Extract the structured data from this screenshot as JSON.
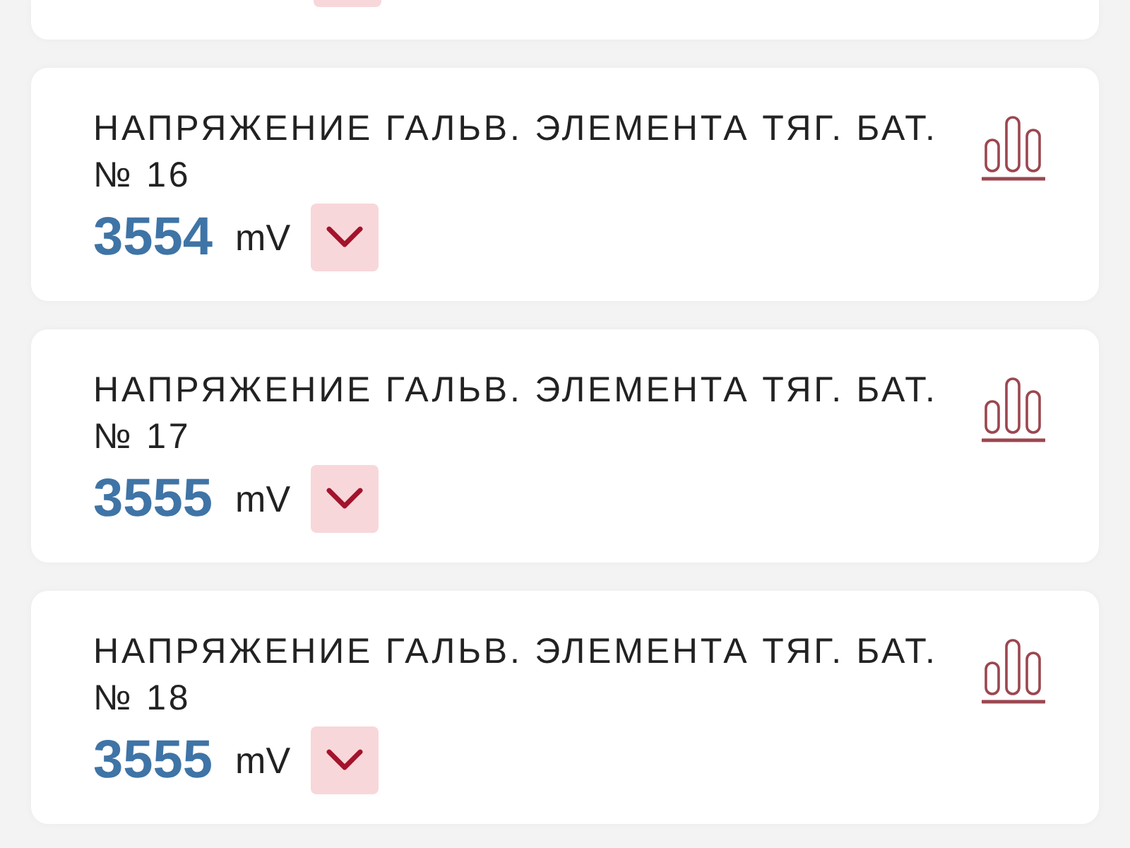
{
  "partial_card": {
    "expand_button": true
  },
  "cards": [
    {
      "title": "НАПРЯЖЕНИЕ ГАЛЬВ. ЭЛЕМЕНТА ТЯГ. БАТ. № 16",
      "value": "3554",
      "unit": "mV",
      "expanded": false
    },
    {
      "title": "НАПРЯЖЕНИЕ ГАЛЬВ. ЭЛЕМЕНТА ТЯГ. БАТ. № 17",
      "value": "3555",
      "unit": "mV",
      "expanded": false
    },
    {
      "title": "НАПРЯЖЕНИЕ ГАЛЬВ. ЭЛЕМЕНТА ТЯГ. БАТ. № 18",
      "value": "3555",
      "unit": "mV",
      "expanded": false
    }
  ]
}
